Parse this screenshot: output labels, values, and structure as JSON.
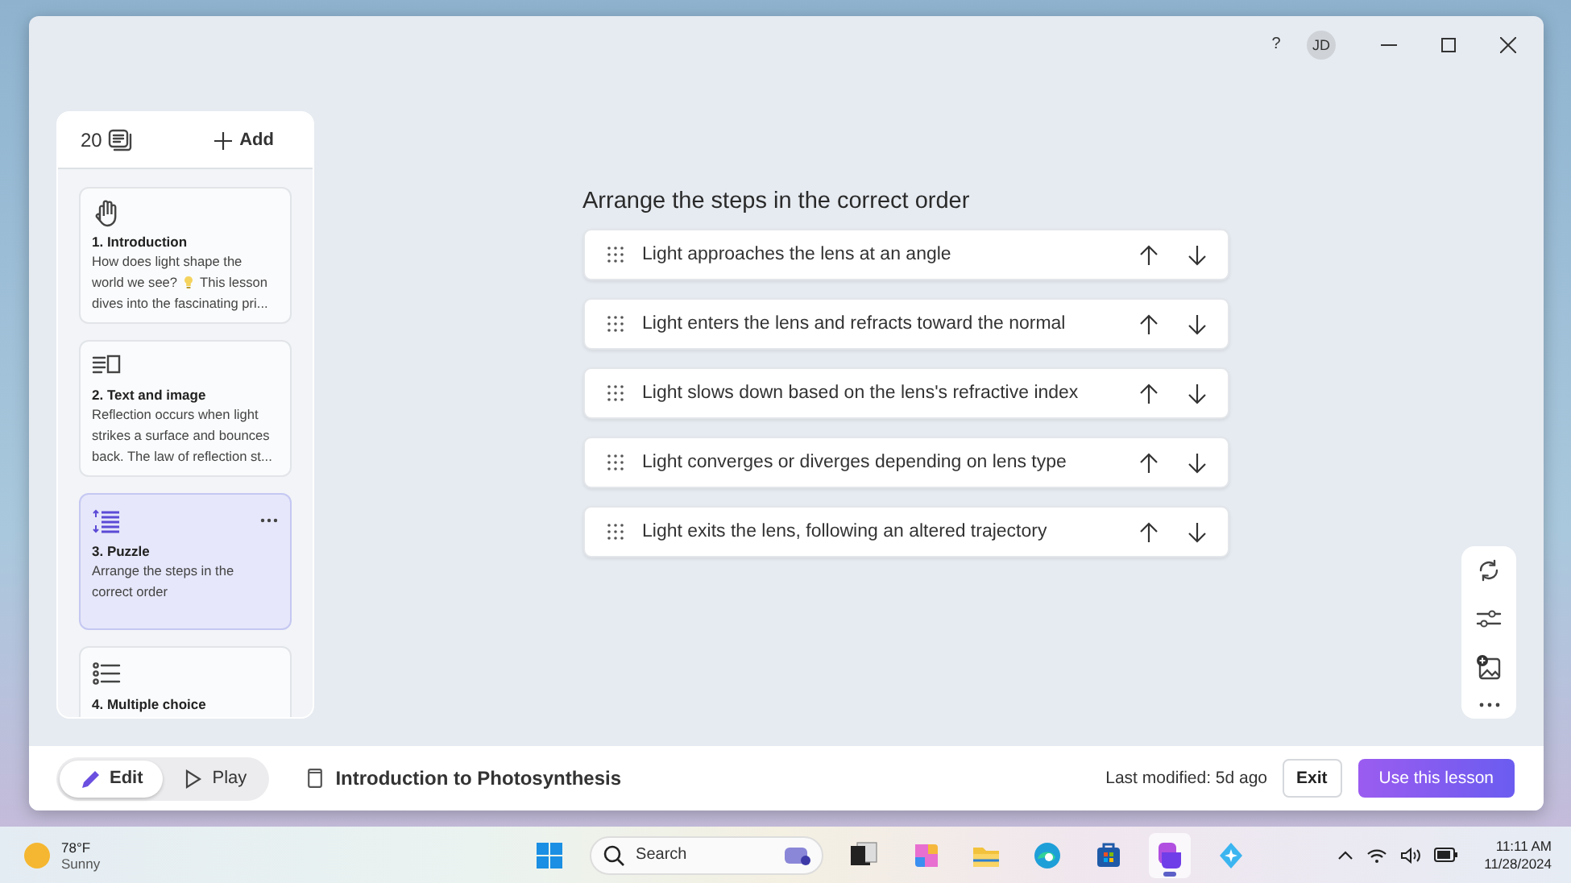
{
  "window": {
    "controls": {
      "help": "?",
      "avatar": "JD"
    }
  },
  "sidebar": {
    "count": "20",
    "add_label": "Add",
    "slides": [
      {
        "kind": "hand",
        "title": "1. Introduction",
        "description": [
          [
            "How does light shape the"
          ],
          [
            "world we see?",
            "This lesson"
          ],
          [
            "dives into the fascinating pri..."
          ]
        ],
        "selected": false
      },
      {
        "kind": "text-image",
        "title": "2. Text and image",
        "description": [
          [
            "Reflection occurs when light"
          ],
          [
            "strikes a surface and bounces"
          ],
          [
            "back. The law of reflection st..."
          ]
        ],
        "selected": false
      },
      {
        "kind": "puzzle",
        "title": "3. Puzzle",
        "description": [
          [
            "Arrange the steps in the"
          ],
          [
            "correct order"
          ]
        ],
        "selected": true
      },
      {
        "kind": "list",
        "title": "4. Multiple choice",
        "selected": false
      }
    ]
  },
  "puzzle": {
    "title": "Arrange the steps in the correct order",
    "steps": [
      {
        "text": "Light approaches the lens at an angle"
      },
      {
        "text": "Light enters the lens and refracts toward the normal"
      },
      {
        "text": "Light slows down based on the lens's refractive index"
      },
      {
        "text": "Light converges or diverges depending on lens type"
      },
      {
        "text": "Light exits the lens, following an altered trajectory"
      }
    ]
  },
  "footer": {
    "modes": [
      {
        "kind": "edit",
        "label": "Edit",
        "selected": true
      },
      {
        "kind": "play",
        "label": "Play",
        "selected": false
      }
    ],
    "lesson_title": "Introduction to Photosynthesis",
    "last_modified": "Last modified: 5d ago",
    "exit": "Exit",
    "primary": "Use this lesson"
  },
  "taskbar": {
    "weather": {
      "temp": "78°F",
      "condition": "Sunny"
    },
    "search": {
      "placeholder": "Search"
    },
    "apps": [
      {
        "kind": "task-view",
        "selected": false
      },
      {
        "kind": "swirl",
        "selected": false
      },
      {
        "kind": "folder",
        "selected": false
      },
      {
        "kind": "browser",
        "selected": false
      },
      {
        "kind": "store",
        "selected": false
      },
      {
        "kind": "chat",
        "selected": true
      },
      {
        "kind": "sparkle",
        "selected": false
      }
    ],
    "time": "11:11 AM",
    "date": "11/28/2024"
  }
}
